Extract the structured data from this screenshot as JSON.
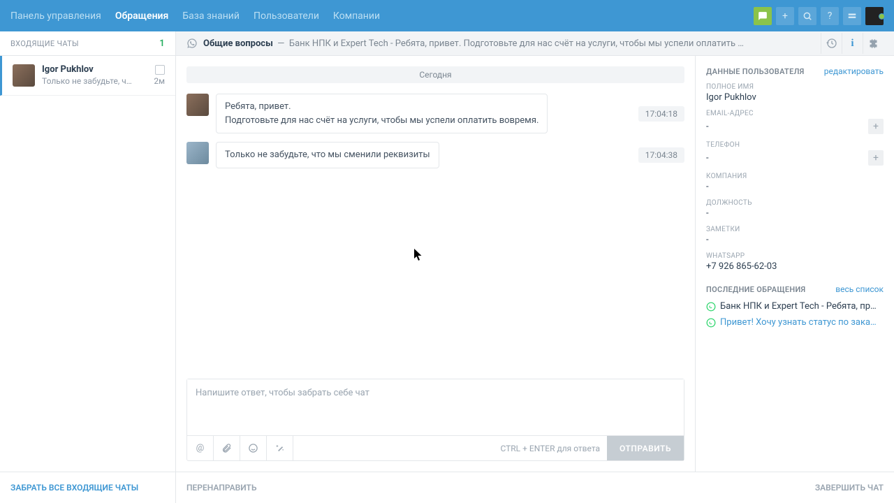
{
  "nav": {
    "items": [
      "Панель управления",
      "Обращения",
      "База знаний",
      "Пользователи",
      "Компании"
    ],
    "active": 1
  },
  "sidebar": {
    "title": "ВХОДЯЩИЕ ЧАТЫ",
    "count": "1",
    "item": {
      "name": "Igor Pukhlov",
      "preview": "Только не забудьте, чт…",
      "time": "2м"
    },
    "footer": "ЗАБРАТЬ ВСЕ ВХОДЯЩИЕ ЧАТЫ"
  },
  "header": {
    "category": "Общие вопросы",
    "sep": "—",
    "subject": "Банк НПК и Expert Tech - Ребята, привет. Подготовьте для нас счёт на услуги, чтобы мы успели оплатить …"
  },
  "dateSep": "Сегодня",
  "msgs": [
    {
      "line1": "Ребята, привет.",
      "line2": "Подготовьте для нас счёт на услуги, чтобы мы успели оплатить вовремя.",
      "ts": "17:04:18"
    },
    {
      "line1": "Только не забудьте, что мы сменили реквизиты",
      "ts": "17:04:38"
    }
  ],
  "compose": {
    "placeholder": "Напишите ответ, чтобы забрать себе чат",
    "hint": "CTRL + ENTER для ответа",
    "send": "ОТПРАВИТЬ"
  },
  "footer": {
    "redirect": "ПЕРЕНАПРАВИТЬ",
    "end": "ЗАВЕРШИТЬ ЧАТ"
  },
  "info": {
    "headTitle": "ДАННЫЕ ПОЛЬЗОВАТЕЛЯ",
    "edit": "редактировать",
    "fields": {
      "name_label": "ПОЛНОЕ ИМЯ",
      "name_val": "Igor Pukhlov",
      "email_label": "EMAIL-АДРЕС",
      "email_val": "-",
      "phone_label": "ТЕЛЕФОН",
      "phone_val": "-",
      "company_label": "КОМПАНИЯ",
      "company_val": "-",
      "position_label": "ДОЛЖНОСТЬ",
      "position_val": "-",
      "notes_label": "ЗАМЕТКИ",
      "notes_val": "-",
      "wa_label": "WHATSAPP",
      "wa_val": "+7 926 865-62-03"
    },
    "ticketsTitle": "ПОСЛЕДНИЕ ОБРАЩЕНИЯ",
    "ticketsAll": "весь список",
    "tickets": [
      {
        "text": "Банк НПК и Expert Tech - Ребята, пр…"
      },
      {
        "text": "Привет! Хочу узнать статус по зака…"
      }
    ]
  }
}
